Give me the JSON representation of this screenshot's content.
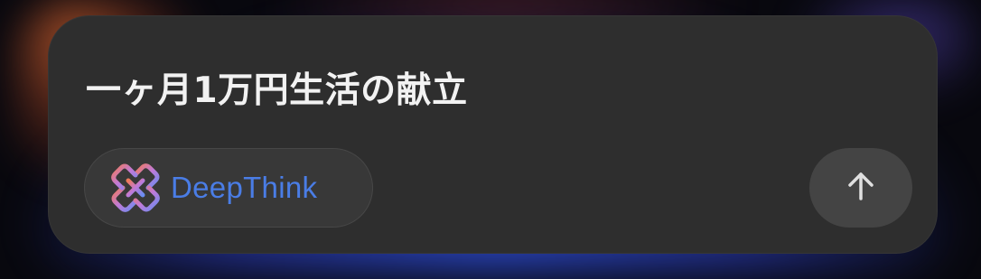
{
  "prompt": {
    "text": "一ヶ月1万円生活の献立"
  },
  "deepthink": {
    "label": "DeepThink",
    "icon": "deepthink-logo-icon",
    "color": "#4a7de6"
  },
  "send": {
    "icon": "arrow-up-icon"
  }
}
